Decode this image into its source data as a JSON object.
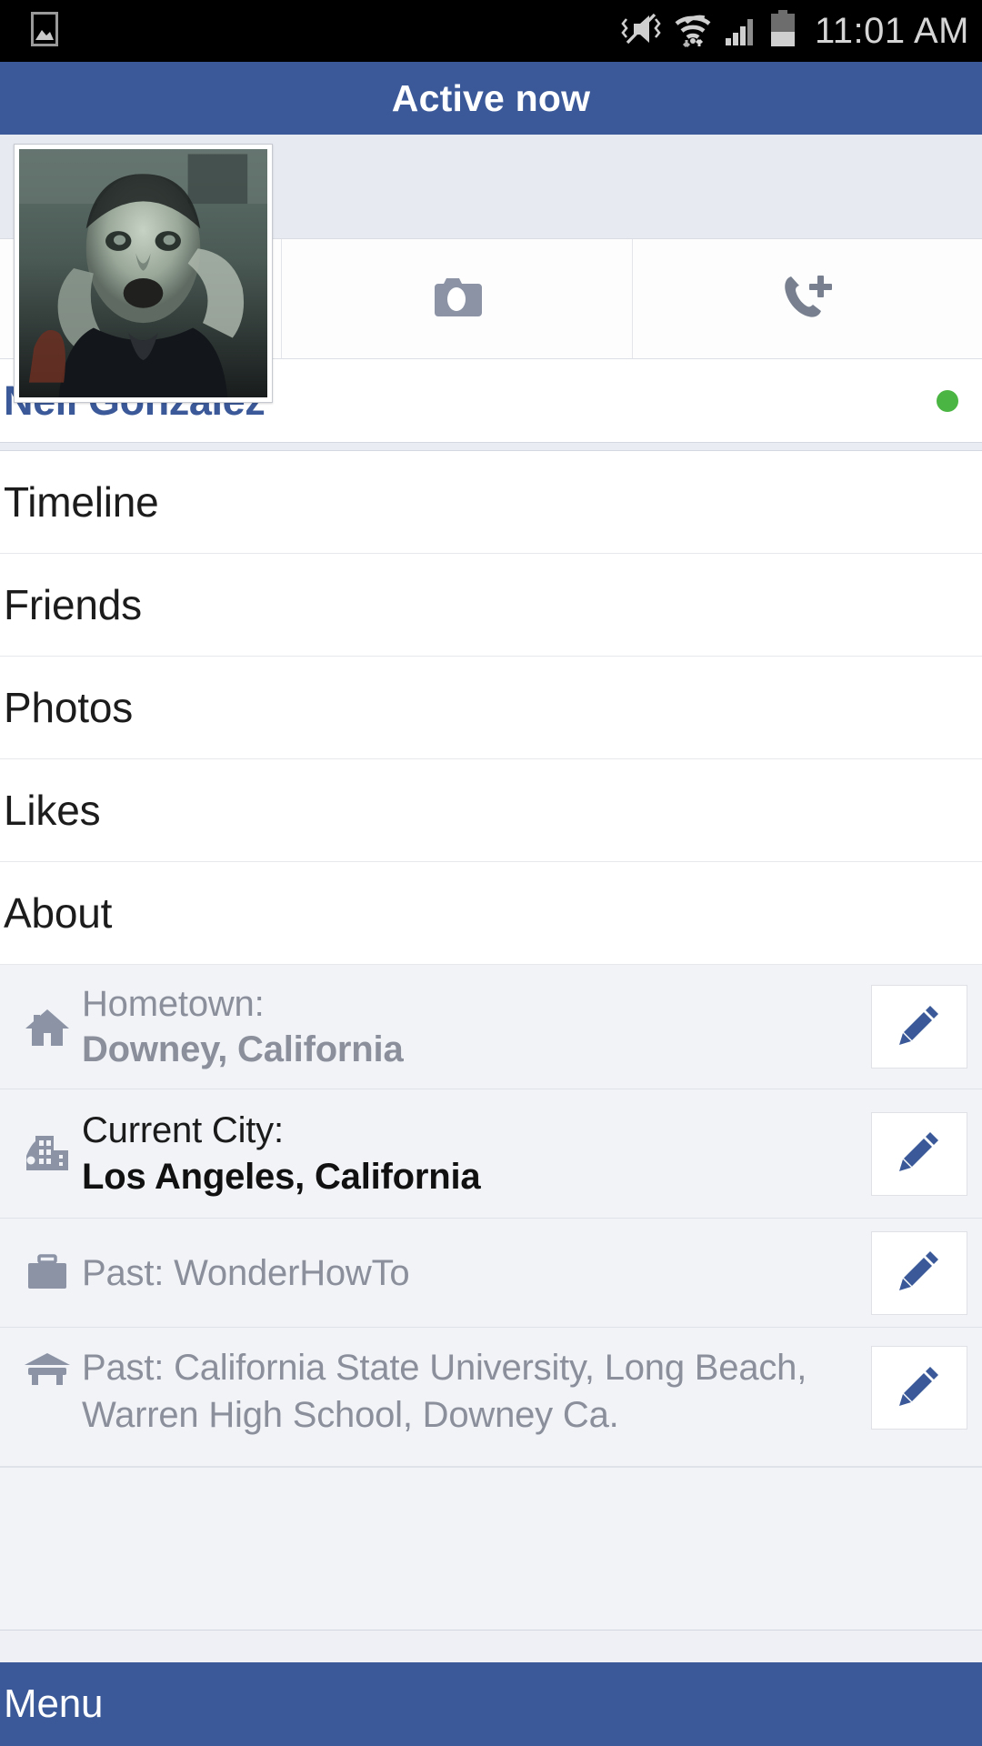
{
  "statusbar": {
    "time": "11:01 AM",
    "icons": [
      "image-icon",
      "mute-vibrate-icon",
      "wifi-icon",
      "signal-icon",
      "battery-icon"
    ]
  },
  "header": {
    "title": "Active now",
    "bg": "#3b5998"
  },
  "profile": {
    "name": "Neil Gonzalez",
    "name_color": "#3b5998",
    "online": true,
    "online_color": "#4bb543",
    "avatar_alt": "profile-photo"
  },
  "actions": [
    {
      "name": "camera-button",
      "icon": "camera-icon"
    },
    {
      "name": "add-call-button",
      "icon": "phone-plus-icon"
    }
  ],
  "nav": {
    "items": [
      {
        "label": "Timeline"
      },
      {
        "label": "Friends"
      },
      {
        "label": "Photos"
      },
      {
        "label": "Likes"
      },
      {
        "label": "About"
      }
    ]
  },
  "info": {
    "edit_label": "edit",
    "rows": [
      {
        "icon": "home-icon",
        "label": "Hometown:",
        "value": "Downey, California",
        "style": "muted",
        "two_line": true
      },
      {
        "icon": "city-icon",
        "label": "Current City:",
        "value": "Los Angeles, California",
        "style": "dark",
        "two_line": true
      },
      {
        "icon": "briefcase-icon",
        "label": "Past: WonderHowTo",
        "value": "",
        "style": "muted",
        "two_line": false
      },
      {
        "icon": "education-icon",
        "label": "Past: California State University, Long Beach, Warren High School, Downey Ca.",
        "value": "",
        "style": "muted",
        "two_line": false
      }
    ]
  },
  "footer": {
    "menu_label": "Menu",
    "bg": "#3b5998"
  },
  "colors": {
    "facebook_blue": "#3b5998",
    "info_bg": "#f1f3f7",
    "muted_text": "#8a8f9b",
    "icon_gray": "#8b93a5"
  }
}
